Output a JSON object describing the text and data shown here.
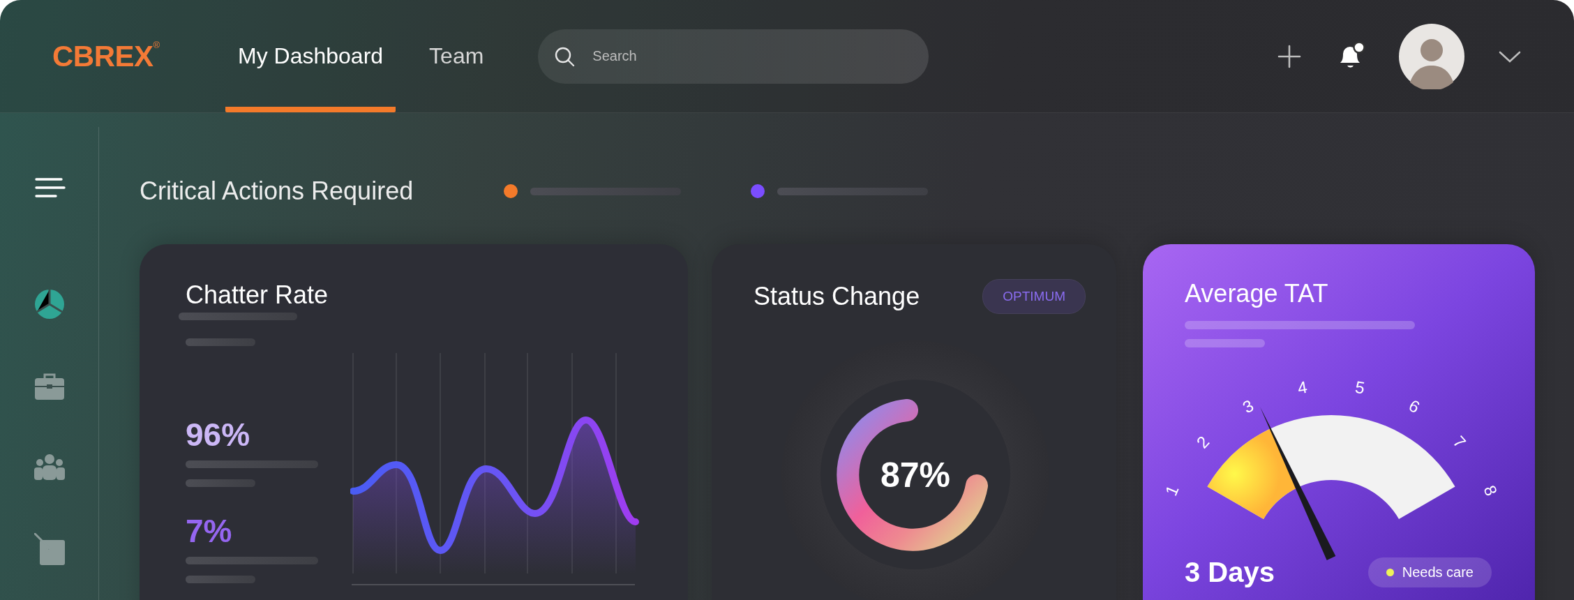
{
  "header": {
    "logo": "CBREX$^{®}$",
    "tabs": [
      {
        "label": "My Dashboard",
        "selected": true
      },
      {
        "label": "Team",
        "selected": false
      }
    ],
    "search": {
      "placeholder": "Search"
    },
    "notifications": {
      "unread": true
    }
  },
  "sidebar": {
    "items": [
      {
        "selected": true
      },
      {
        "selected": false
      },
      {
        "selected": false
      },
      {
        "selected": false
      }
    ]
  },
  "section_title": "Critical Actions Required",
  "legend": [
    {
      "color": "#f47a2a"
    },
    {
      "color": "#7b4dff"
    }
  ],
  "chatter_rate": {
    "title": "Chatter Rate",
    "stats": [
      {
        "value": "96%",
        "kind": "primary"
      },
      {
        "value": "7%",
        "kind": "secondary"
      }
    ]
  },
  "status_change": {
    "title": "Status Change",
    "badge": "OPTIMUM",
    "value": "87%"
  },
  "average_tat": {
    "title": "Average TAT",
    "gauge_labels": [
      "1",
      "2",
      "3",
      "4",
      "5",
      "6",
      "7",
      "8"
    ],
    "level": 0.29,
    "value": "3 Days",
    "status": {
      "label": "Needs care",
      "color": "#eef35a"
    }
  }
}
